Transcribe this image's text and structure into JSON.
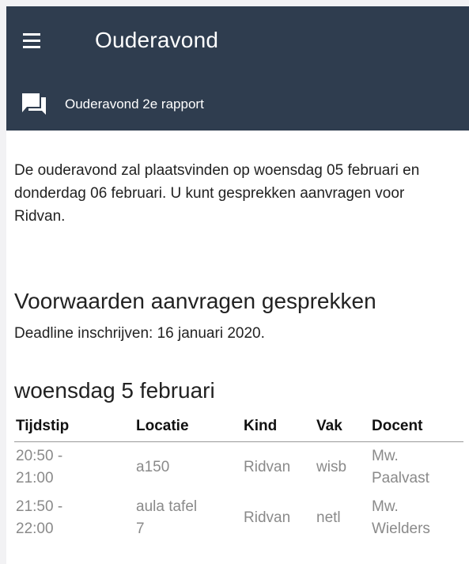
{
  "appbar": {
    "title": "Ouderavond",
    "subtitle": "Ouderavond 2e rapport"
  },
  "content": {
    "intro": "De ouderavond zal plaatsvinden op woensdag 05 februari en donderdag 06 februari. U kunt gesprekken aanvragen voor Ridvan.",
    "section_heading": "Voorwaarden aanvragen gesprekken",
    "deadline": "Deadline inschrijven: 16 januari 2020.",
    "day_heading": "woensdag 5 februari",
    "table": {
      "headers": [
        "Tijdstip",
        "Locatie",
        "Kind",
        "Vak",
        "Docent"
      ],
      "rows": [
        {
          "time_start": "20:50 -",
          "time_end": "21:00",
          "location_1": "a150",
          "location_2": "",
          "kind": "Ridvan",
          "vak": "wisb",
          "docent_1": "Mw.",
          "docent_2": "Paalvast"
        },
        {
          "time_start": "21:50 -",
          "time_end": "22:00",
          "location_1": "aula tafel",
          "location_2": "7",
          "kind": "Ridvan",
          "vak": "netl",
          "docent_1": "Mw.",
          "docent_2": "Wielders"
        }
      ]
    }
  },
  "colors": {
    "appbar_bg": "#2f3d4f",
    "muted_text": "#8a8a8a"
  },
  "icons": [
    "menu-icon",
    "chat-icon"
  ]
}
